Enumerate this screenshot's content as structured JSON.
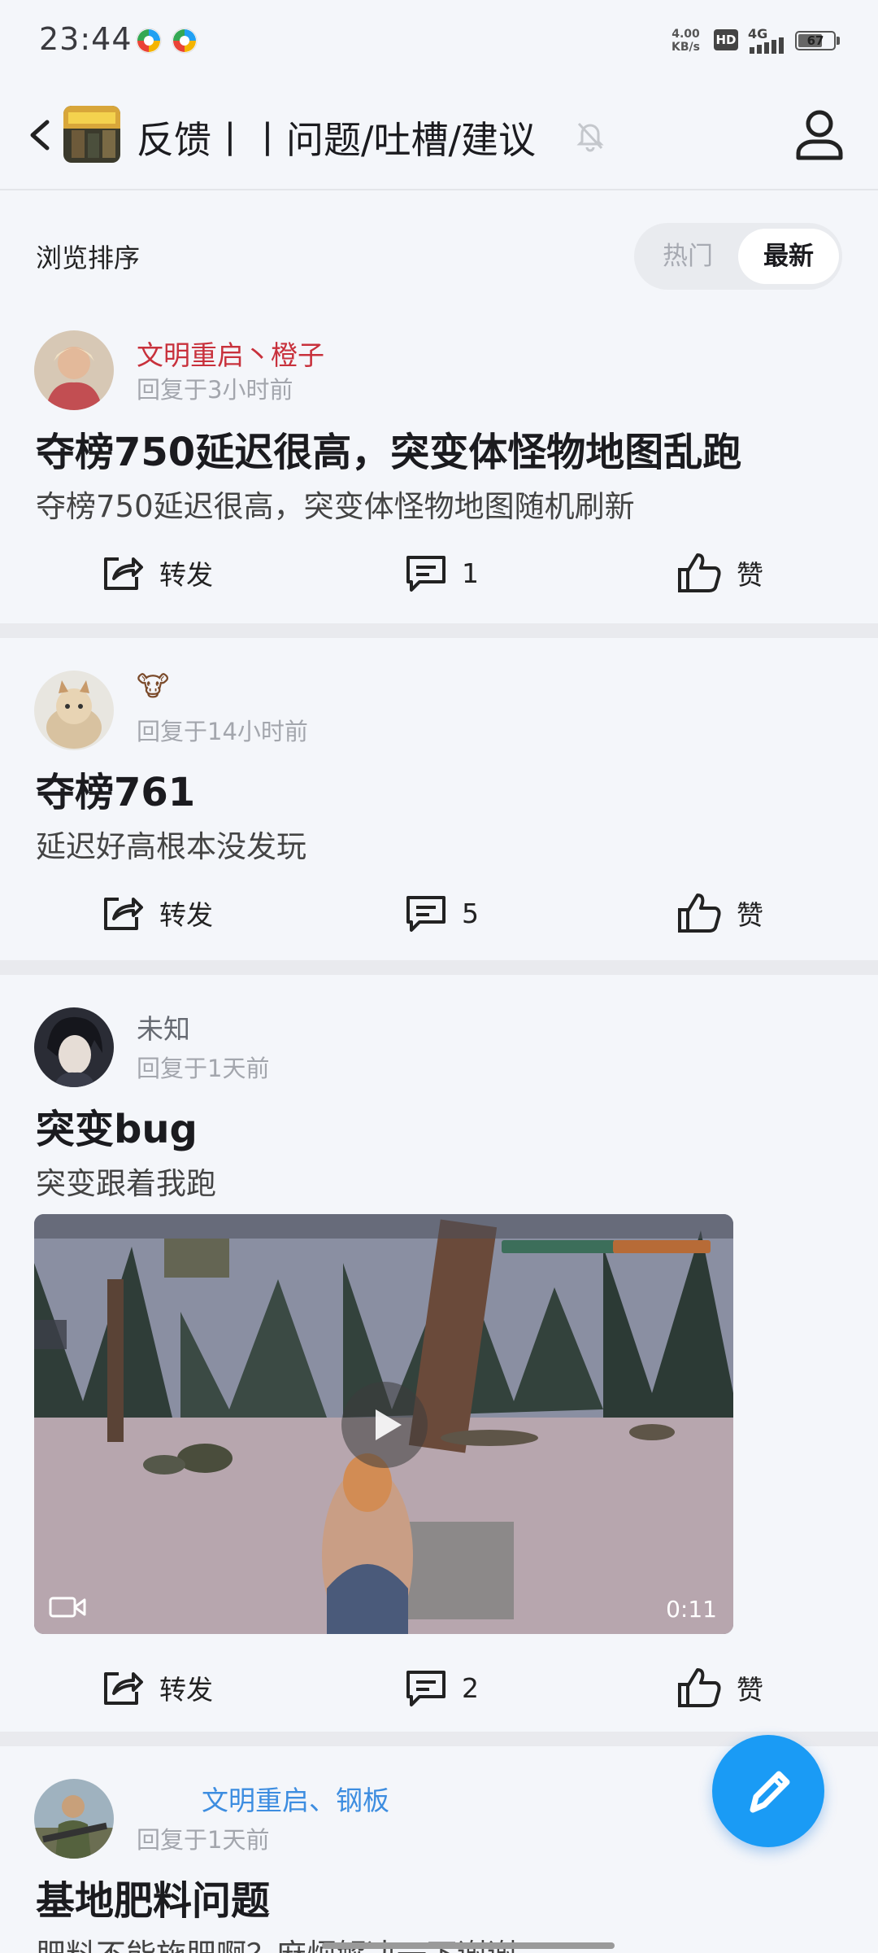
{
  "status_bar": {
    "time": "23:44",
    "net_speed": "4.00",
    "net_unit": "KB/s",
    "hd_badge": "HD",
    "network": "4G",
    "battery": "67"
  },
  "header": {
    "forum_name": "反馈丨丨问题/吐槽/建议",
    "icons": [
      "back-icon",
      "forum-avatar",
      "bell-off-icon",
      "user-icon"
    ]
  },
  "sort": {
    "label": "浏览排序",
    "hot": "热门",
    "latest": "最新",
    "selected": "最新"
  },
  "posts": [
    {
      "author": "文明重启丶橙子",
      "author_color": "#c8313c",
      "reply_time": "回复于3小时前",
      "title": "夺榜750延迟很高，突变体怪物地图乱跑",
      "body": "夺榜750延迟很高，突变体怪物地图随机刷新",
      "share_label": "转发",
      "comment_count": "1",
      "like_label": "赞"
    },
    {
      "author": "🐮",
      "author_color": "#7a4a2a",
      "reply_time": "回复于14小时前",
      "title": "夺榜761",
      "body": "延迟好高根本没发玩",
      "share_label": "转发",
      "comment_count": "5",
      "like_label": "赞"
    },
    {
      "author": "未知",
      "author_color": "#666a72",
      "reply_time": "回复于1天前",
      "title": "突变bug",
      "body": "突变跟着我跑",
      "video_duration": "0:11",
      "share_label": "转发",
      "comment_count": "2",
      "like_label": "赞"
    },
    {
      "author": "文明重启、钢板",
      "author_color": "#3d8de0",
      "reply_time": "回复于1天前",
      "title": "基地肥料问题",
      "body": "肥料不能施肥啊？麻烦解决一下谢谢"
    }
  ],
  "fab": {
    "icon": "pencil-icon"
  }
}
